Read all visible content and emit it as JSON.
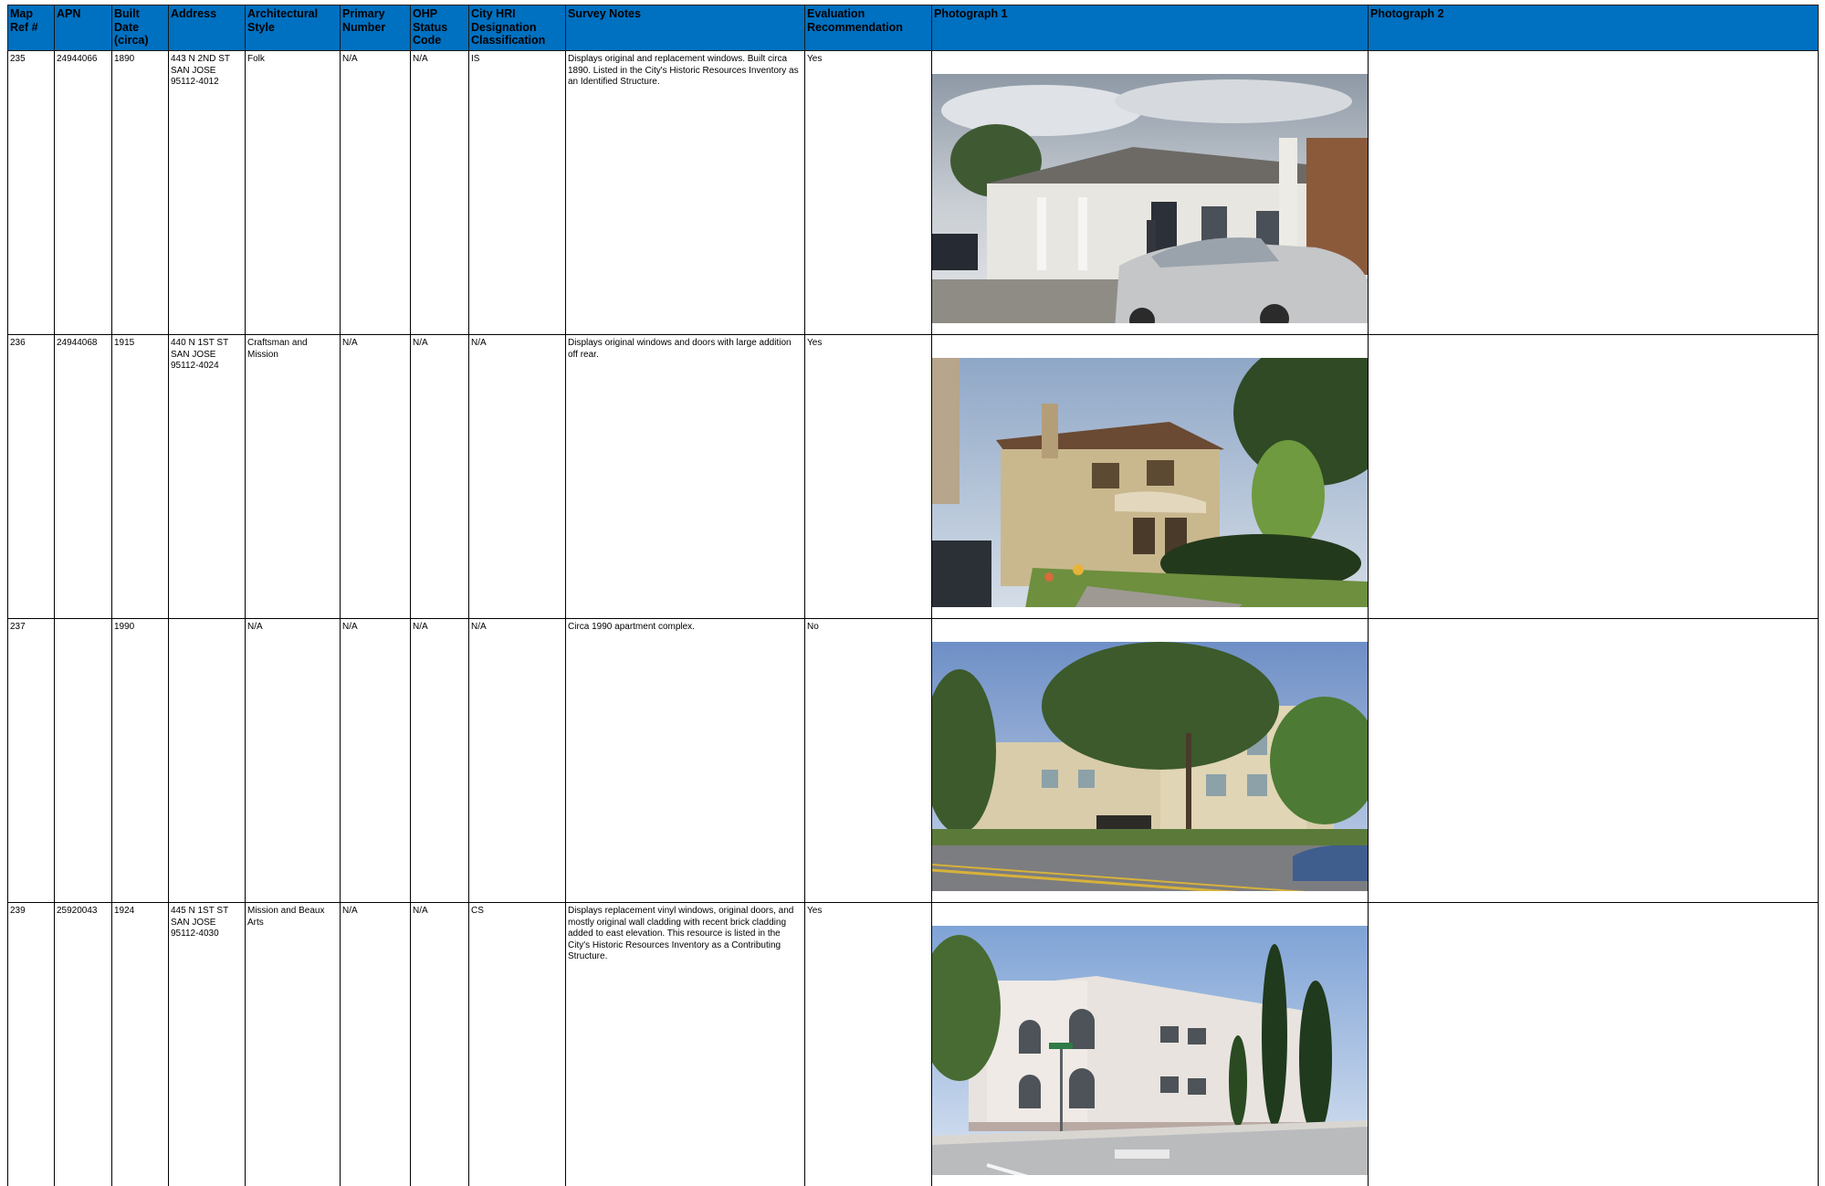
{
  "headers": {
    "map_ref": "Map\nRef #",
    "apn": "APN",
    "built_date": "Built Date\n(circa)",
    "address": "Address",
    "arch_style": "Architectural\nStyle",
    "primary_number": "Primary\nNumber",
    "ohp_status": "OHP\nStatus\nCode",
    "hri": "City HRI\nDesignation\nClassification",
    "survey_notes": "Survey Notes",
    "evaluation": "Evaluation\nRecommendation",
    "photo1": "Photograph 1",
    "photo2": "Photograph 2"
  },
  "rows": [
    {
      "map_ref": "235",
      "apn": "24944066",
      "built_date": "1890",
      "address": "443 N 2ND ST\nSAN JOSE\n95112-4012",
      "arch_style": "Folk",
      "primary_number": "N/A",
      "ohp_status": "N/A",
      "hri": "IS",
      "survey_notes": "Displays original and replacement windows. Built circa 1890. Listed in the City's Historic Resources Inventory as an Identified Structure.",
      "evaluation": "Yes",
      "photo1": "white-folk-house-with-silver-sedan-photo",
      "photo2": ""
    },
    {
      "map_ref": "236",
      "apn": "24944068",
      "built_date": "1915",
      "address": "440 N 1ST ST\nSAN JOSE\n95112-4024",
      "arch_style": "Craftsman and\nMission",
      "primary_number": "N/A",
      "ohp_status": "N/A",
      "hri": "N/A",
      "survey_notes": "Displays original windows and doors with large addition off rear.",
      "evaluation": "Yes",
      "photo1": "tan-craftsman-house-with-hedges-photo",
      "photo2": ""
    },
    {
      "map_ref": "237",
      "apn": "",
      "built_date": "1990",
      "address": "",
      "arch_style": "N/A",
      "primary_number": "N/A",
      "ohp_status": "N/A",
      "hri": "N/A",
      "survey_notes": "Circa 1990 apartment complex.",
      "evaluation": "No",
      "photo1": "beige-apartment-complex-with-street-photo",
      "photo2": ""
    },
    {
      "map_ref": "239",
      "apn": "25920043",
      "built_date": "1924",
      "address": "445 N 1ST ST\nSAN JOSE\n95112-4030",
      "arch_style": "Mission and Beaux\nArts",
      "primary_number": "N/A",
      "ohp_status": "N/A",
      "hri": "CS",
      "survey_notes": "Displays replacement vinyl windows, original doors, and mostly original wall cladding with recent brick cladding added to east elevation. This resource is listed in the City's Historic Resources Inventory as a Contributing Structure.",
      "evaluation": "Yes",
      "photo1": "white-mission-beaux-arts-building-with-cypress-photo",
      "photo2": ""
    }
  ],
  "colors": {
    "header_bg": "#0070c0",
    "grid_line": "#000000"
  }
}
